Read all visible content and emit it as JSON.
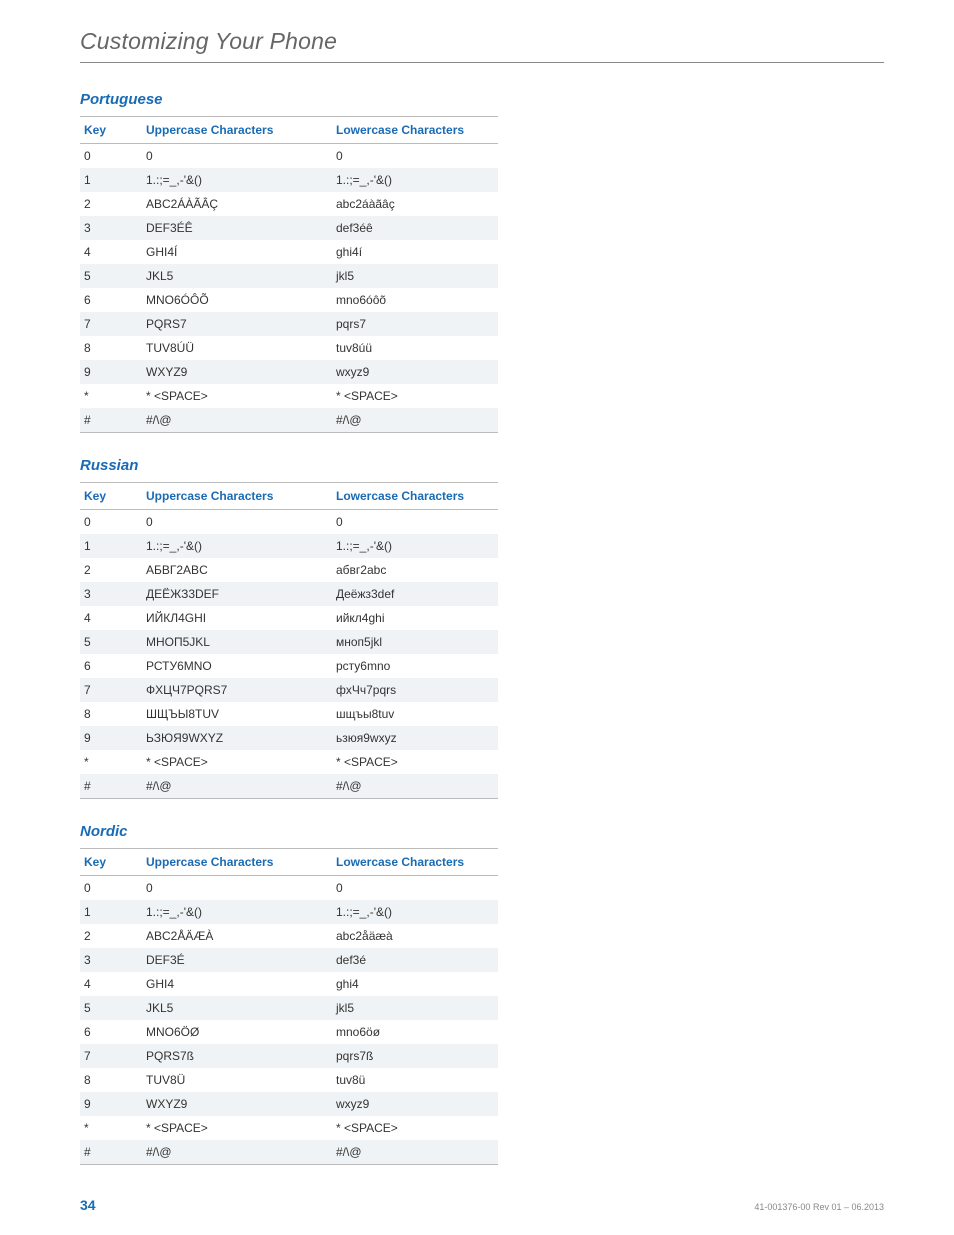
{
  "page_title": "Customizing Your Phone",
  "footer": {
    "page_number": "34",
    "doc_rev": "41-001376-00 Rev 01 – 06.2013"
  },
  "columns": {
    "key": "Key",
    "upper": "Uppercase Characters",
    "lower": "Lowercase Characters"
  },
  "sections": [
    {
      "heading": "Portuguese",
      "rows": [
        {
          "key": "0",
          "upper": "0",
          "lower": "0"
        },
        {
          "key": "1",
          "upper": "1.:;=_,-'&()",
          "lower": "1.:;=_,-'&()"
        },
        {
          "key": "2",
          "upper": "ABC2ÁÀÃÂÇ",
          "lower": "abc2áàãâç"
        },
        {
          "key": "3",
          "upper": "DEF3ÉÊ",
          "lower": "def3éê"
        },
        {
          "key": "4",
          "upper": "GHI4Í",
          "lower": "ghi4í"
        },
        {
          "key": "5",
          "upper": "JKL5",
          "lower": "jkl5"
        },
        {
          "key": "6",
          "upper": "MNO6ÓÔÕ",
          "lower": "mno6óôõ"
        },
        {
          "key": "7",
          "upper": "PQRS7",
          "lower": "pqrs7"
        },
        {
          "key": "8",
          "upper": "TUV8ÚÜ",
          "lower": "tuv8úü"
        },
        {
          "key": "9",
          "upper": "WXYZ9",
          "lower": "wxyz9"
        },
        {
          "key": "*",
          "upper": "* <SPACE>",
          "lower": "* <SPACE>"
        },
        {
          "key": "#",
          "upper": "#/\\@",
          "lower": "#/\\@"
        }
      ]
    },
    {
      "heading": "Russian",
      "rows": [
        {
          "key": "0",
          "upper": "0",
          "lower": "0"
        },
        {
          "key": "1",
          "upper": "1.:;=_,-'&()",
          "lower": "1.:;=_,-'&()"
        },
        {
          "key": "2",
          "upper": "АБВГ2ABC",
          "lower": "абвг2abc"
        },
        {
          "key": "3",
          "upper": "ДЕЁЖЗ3DEF",
          "lower": "Деёжз3def"
        },
        {
          "key": "4",
          "upper": "ИЙКЛ4GHI",
          "lower": "ийкл4ghi"
        },
        {
          "key": "5",
          "upper": "МНОП5JKL",
          "lower": "мноп5jkl"
        },
        {
          "key": "6",
          "upper": "РСТУ6MNO",
          "lower": "рсту6mno"
        },
        {
          "key": "7",
          "upper": "ФХЦЧ7PQRS7",
          "lower": "фхЧч7pqrs"
        },
        {
          "key": "8",
          "upper": "ШЩЪЫ8TUV",
          "lower": "шщъы8tuv"
        },
        {
          "key": "9",
          "upper": "ЬЗЮЯ9WXYZ",
          "lower": "ьзюя9wxyz"
        },
        {
          "key": "*",
          "upper": "* <SPACE>",
          "lower": "* <SPACE>"
        },
        {
          "key": "#",
          "upper": "#/\\@",
          "lower": "#/\\@"
        }
      ]
    },
    {
      "heading": "Nordic",
      "rows": [
        {
          "key": "0",
          "upper": "0",
          "lower": "0"
        },
        {
          "key": "1",
          "upper": "1.:;=_,-'&()",
          "lower": "1.:;=_,-'&()"
        },
        {
          "key": "2",
          "upper": "ABC2ÅÄÆÀ",
          "lower": "abc2åäæà"
        },
        {
          "key": "3",
          "upper": "DEF3É",
          "lower": "def3é"
        },
        {
          "key": "4",
          "upper": "GHI4",
          "lower": "ghi4"
        },
        {
          "key": "5",
          "upper": "JKL5",
          "lower": "jkl5"
        },
        {
          "key": "6",
          "upper": "MNO6ÖØ",
          "lower": "mno6öø"
        },
        {
          "key": "7",
          "upper": "PQRS7ß",
          "lower": "pqrs7ß"
        },
        {
          "key": "8",
          "upper": "TUV8Ü",
          "lower": "tuv8ü"
        },
        {
          "key": "9",
          "upper": "WXYZ9",
          "lower": "wxyz9"
        },
        {
          "key": "*",
          "upper": "* <SPACE>",
          "lower": "* <SPACE>"
        },
        {
          "key": "#",
          "upper": "#/\\@",
          "lower": "#/\\@"
        }
      ]
    }
  ]
}
